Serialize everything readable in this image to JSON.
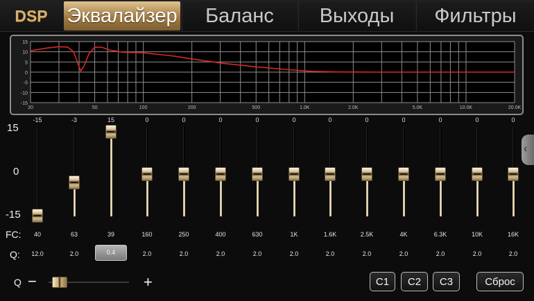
{
  "header": {
    "logo": "DSP",
    "tabs": [
      {
        "label": "Эквалайзер",
        "active": true
      },
      {
        "label": "Баланс",
        "active": false
      },
      {
        "label": "Выходы",
        "active": false
      },
      {
        "label": "Фильтры",
        "active": false
      }
    ]
  },
  "graph": {
    "y_ticks": [
      "15",
      "10",
      "5",
      "0",
      "-5",
      "-10",
      "-15"
    ],
    "x_ticks": [
      "20",
      "50",
      "100",
      "200",
      "500",
      "1.0K",
      "2.0K",
      "5.0K",
      "10.0K",
      "20.0K"
    ],
    "curve_color": "#d62a2a"
  },
  "scale": {
    "top": "15",
    "mid": "0",
    "bottom": "-15"
  },
  "row_labels": {
    "fc": "FC:",
    "q": "Q:"
  },
  "bands": [
    {
      "value": "-15",
      "gain": -15,
      "fc": "40",
      "q": "12.0"
    },
    {
      "value": "-3",
      "gain": -3,
      "fc": "63",
      "q": "2.0"
    },
    {
      "value": "15",
      "gain": 15,
      "fc": "39",
      "q": "0.4",
      "selected": true
    },
    {
      "value": "0",
      "gain": 0,
      "fc": "160",
      "q": "2.0"
    },
    {
      "value": "0",
      "gain": 0,
      "fc": "250",
      "q": "2.0"
    },
    {
      "value": "0",
      "gain": 0,
      "fc": "400",
      "q": "2.0"
    },
    {
      "value": "0",
      "gain": 0,
      "fc": "630",
      "q": "2.0"
    },
    {
      "value": "0",
      "gain": 0,
      "fc": "1K",
      "q": "2.0"
    },
    {
      "value": "0",
      "gain": 0,
      "fc": "1.6K",
      "q": "2.0"
    },
    {
      "value": "0",
      "gain": 0,
      "fc": "2.5K",
      "q": "2.0"
    },
    {
      "value": "0",
      "gain": 0,
      "fc": "4K",
      "q": "2.0"
    },
    {
      "value": "0",
      "gain": 0,
      "fc": "6.3K",
      "q": "2.0"
    },
    {
      "value": "0",
      "gain": 0,
      "fc": "10K",
      "q": "2.0"
    },
    {
      "value": "0",
      "gain": 0,
      "fc": "16K",
      "q": "2.0"
    }
  ],
  "q_control": {
    "label": "Q",
    "minus": "−",
    "plus": "+",
    "level": 0.05
  },
  "presets": {
    "c1": "C1",
    "c2": "C2",
    "c3": "C3",
    "reset": "Сброс"
  },
  "icons": {
    "side_handle": "chevron-left-icon"
  }
}
